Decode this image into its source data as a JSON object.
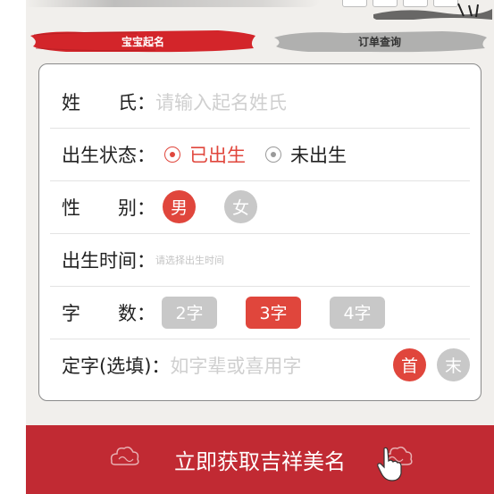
{
  "tabs": [
    {
      "label": "宝宝起名",
      "active": true
    },
    {
      "label": "订单查询",
      "active": false
    }
  ],
  "form": {
    "surname": {
      "label": "姓　　氏：",
      "placeholder": "请输入起名姓氏"
    },
    "birth_status": {
      "label": "出生状态：",
      "options": [
        {
          "label": "已出生",
          "selected": true
        },
        {
          "label": "未出生",
          "selected": false
        }
      ]
    },
    "gender": {
      "label": "性　　别：",
      "options": [
        {
          "label": "男",
          "selected": true
        },
        {
          "label": "女",
          "selected": false
        }
      ]
    },
    "birth_time": {
      "label": "出生时间：",
      "placeholder": "请选择出生时间"
    },
    "char_count": {
      "label": "字　　数：",
      "options": [
        {
          "label": "2字",
          "selected": false
        },
        {
          "label": "3字",
          "selected": true
        },
        {
          "label": "4字",
          "selected": false
        }
      ]
    },
    "fixed_char": {
      "label": "定字(选填)：",
      "placeholder": "如字辈或喜用字",
      "positions": [
        {
          "label": "首",
          "selected": true
        },
        {
          "label": "末",
          "selected": false
        }
      ]
    }
  },
  "cta": {
    "label": "立即获取吉祥美名"
  },
  "colors": {
    "accent": "#e0463c",
    "cta_bg": "#c12a33",
    "inactive": "#c8c8c8",
    "panel_bg": "#f1efec"
  },
  "icons": [
    "radio-selected-icon",
    "radio-unselected-icon",
    "cloud-ornament-icon",
    "pointer-hand-icon"
  ]
}
